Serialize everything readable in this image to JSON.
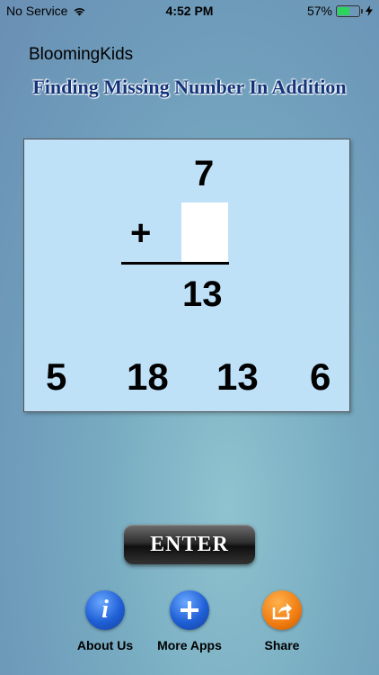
{
  "status": {
    "carrier": "No Service",
    "time": "4:52 PM",
    "battery": "57%",
    "battery_level": 0.57
  },
  "app_name": "BloomingKids",
  "title": "Finding Missing Number In Addition",
  "problem": {
    "addend": "7",
    "operator": "+",
    "sum": "13"
  },
  "choices": [
    "5",
    "18",
    "13",
    "6"
  ],
  "enter_label": "ENTER",
  "bottom": {
    "about": "About Us",
    "more": "More Apps",
    "share": "Share"
  },
  "icons": {
    "about": "info-icon",
    "more": "plus-icon",
    "share": "share-icon"
  },
  "colors": {
    "card": "#bfe1f8",
    "title": "#13347a",
    "battery_fill": "#2bd45b"
  }
}
